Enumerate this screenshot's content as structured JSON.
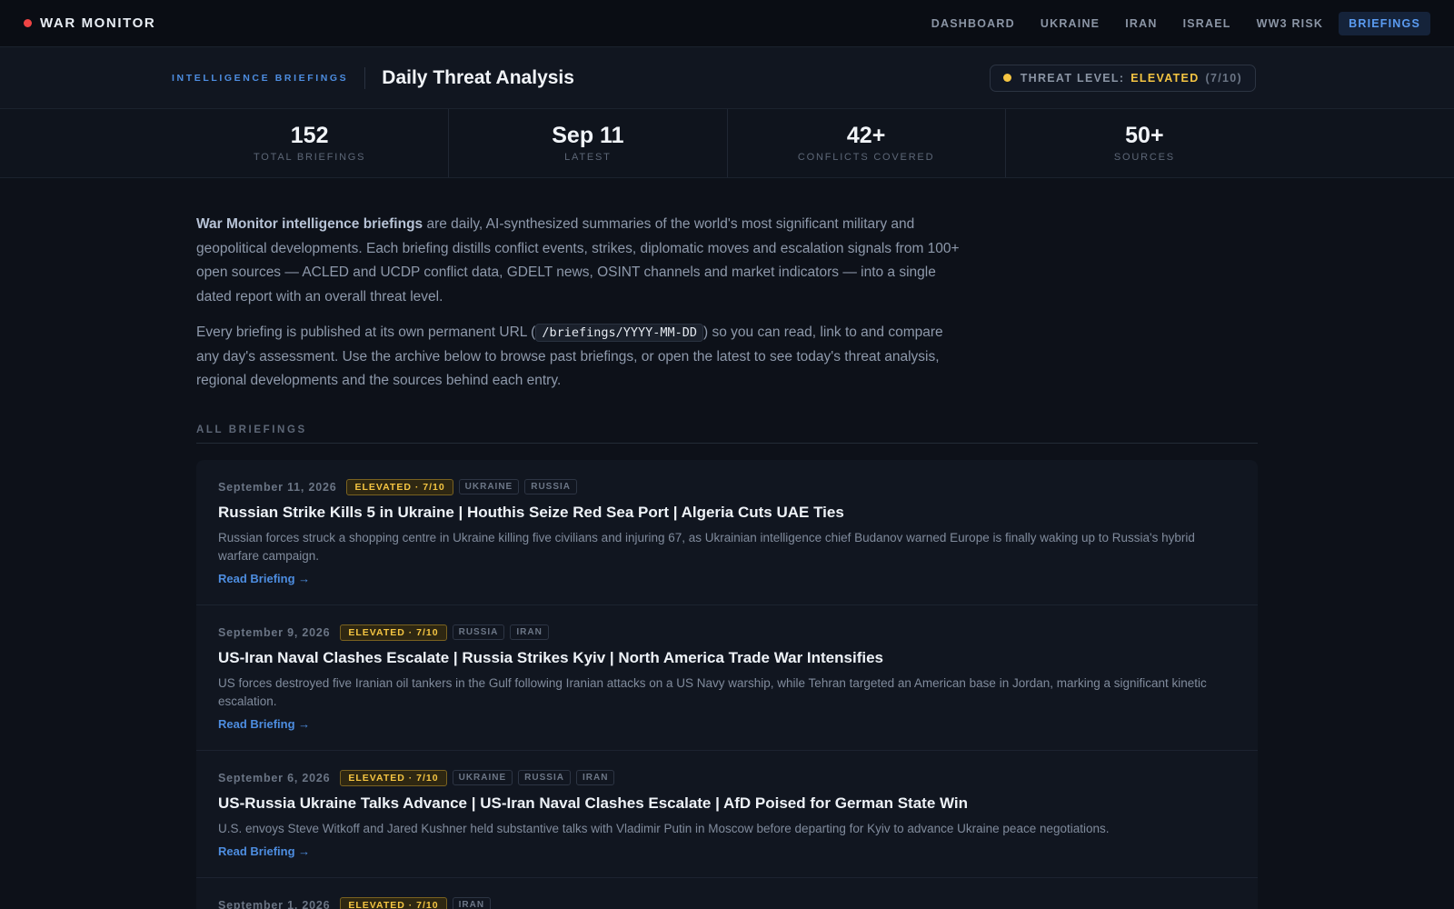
{
  "brand": {
    "name": "WAR MONITOR",
    "accent": "#ef4444"
  },
  "nav": {
    "items": [
      {
        "label": "DASHBOARD"
      },
      {
        "label": "UKRAINE"
      },
      {
        "label": "IRAN"
      },
      {
        "label": "ISRAEL"
      },
      {
        "label": "WW3 RISK"
      },
      {
        "label": "BRIEFINGS",
        "active": true
      }
    ]
  },
  "header": {
    "kicker": "INTELLIGENCE BRIEFINGS",
    "title": "Daily Threat Analysis",
    "threat": {
      "label": "THREAT LEVEL:",
      "value": "ELEVATED",
      "score": "(7/10)",
      "color": "#f5c542"
    }
  },
  "stats": [
    {
      "value": "152",
      "label": "TOTAL BRIEFINGS"
    },
    {
      "value": "Sep 11",
      "label": "LATEST"
    },
    {
      "value": "42+",
      "label": "CONFLICTS COVERED"
    },
    {
      "value": "50+",
      "label": "SOURCES"
    }
  ],
  "intro": {
    "p1_bold": "War Monitor intelligence briefings",
    "p1_rest": " are daily, AI-synthesized summaries of the world's most significant military and geopolitical developments. Each briefing distills conflict events, strikes, diplomatic moves and escalation signals from 100+ open sources — ACLED and UCDP conflict data, GDELT news, OSINT channels and market indicators — into a single dated report with an overall threat level.",
    "p2_before": "Every briefing is published at its own permanent URL (",
    "p2_code": "/briefings/YYYY-MM-DD",
    "p2_after": ") so you can read, link to and compare any day's assessment. Use the archive below to browse past briefings, or open the latest to see today's threat analysis, regional developments and the sources behind each entry."
  },
  "list_heading": "ALL BRIEFINGS",
  "briefings": [
    {
      "date": "September 11, 2026",
      "level": "ELEVATED · 7/10",
      "tags": [
        "UKRAINE",
        "RUSSIA"
      ],
      "title": "Russian Strike Kills 5 in Ukraine | Houthis Seize Red Sea Port | Algeria Cuts UAE Ties",
      "summary": "Russian forces struck a shopping centre in Ukraine killing five civilians and injuring 67, as Ukrainian intelligence chief Budanov warned Europe is finally waking up to Russia's hybrid warfare campaign.",
      "link": "Read Briefing →"
    },
    {
      "date": "September 9, 2026",
      "level": "ELEVATED · 7/10",
      "tags": [
        "RUSSIA",
        "IRAN"
      ],
      "title": "US-Iran Naval Clashes Escalate | Russia Strikes Kyiv | North America Trade War Intensifies",
      "summary": "US forces destroyed five Iranian oil tankers in the Gulf following Iranian attacks on a US Navy warship, while Tehran targeted an American base in Jordan, marking a significant kinetic escalation.",
      "link": "Read Briefing →"
    },
    {
      "date": "September 6, 2026",
      "level": "ELEVATED · 7/10",
      "tags": [
        "UKRAINE",
        "RUSSIA",
        "IRAN"
      ],
      "title": "US-Russia Ukraine Talks Advance | US-Iran Naval Clashes Escalate | AfD Poised for German State Win",
      "summary": "U.S. envoys Steve Witkoff and Jared Kushner held substantive talks with Vladimir Putin in Moscow before departing for Kyiv to advance Ukraine peace negotiations.",
      "link": "Read Briefing →"
    },
    {
      "date": "September 1, 2026",
      "level": "ELEVATED · 7/10",
      "tags": [
        "IRAN"
      ],
      "title": "",
      "summary": "",
      "link": ""
    }
  ]
}
